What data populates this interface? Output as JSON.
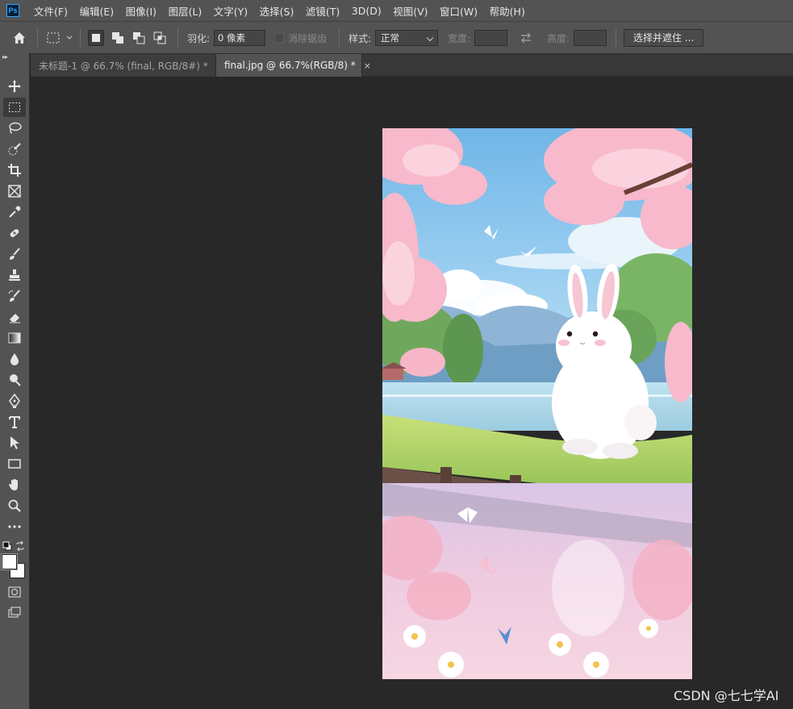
{
  "app": {
    "logo_text": "Ps",
    "menu": [
      "文件(F)",
      "编辑(E)",
      "图像(I)",
      "图层(L)",
      "文字(Y)",
      "选择(S)",
      "滤镜(T)",
      "3D(D)",
      "视图(V)",
      "窗口(W)",
      "帮助(H)"
    ]
  },
  "options": {
    "feather_label": "羽化:",
    "feather_value": "0 像素",
    "antialias_label": "消除锯齿",
    "style_label": "样式:",
    "style_value": "正常",
    "width_label": "宽度:",
    "height_label": "高度:",
    "select_mask_label": "选择并遮住 ..."
  },
  "tabs": [
    {
      "label": "未标题-1 @ 66.7% (final, RGB/8#) *",
      "active": false
    },
    {
      "label": "final.jpg @ 66.7%(RGB/8) *",
      "active": true
    }
  ],
  "tab_close_glyph": "×",
  "tools": [
    "move-tool",
    "rect-marquee-tool",
    "lasso-tool",
    "quick-select-tool",
    "crop-tool",
    "frame-tool",
    "eyedropper-tool",
    "healing-brush-tool",
    "brush-tool",
    "clone-stamp-tool",
    "history-brush-tool",
    "eraser-tool",
    "gradient-tool",
    "blur-tool",
    "dodge-tool",
    "pen-tool",
    "type-tool",
    "path-select-tool",
    "rectangle-tool",
    "hand-tool",
    "zoom-tool",
    "more-tools"
  ],
  "colors": {
    "ui_dark": "#535353",
    "canvas_bg": "#282828",
    "ps_blue": "#31a8ff"
  },
  "watermark": "CSDN @七七学AI"
}
